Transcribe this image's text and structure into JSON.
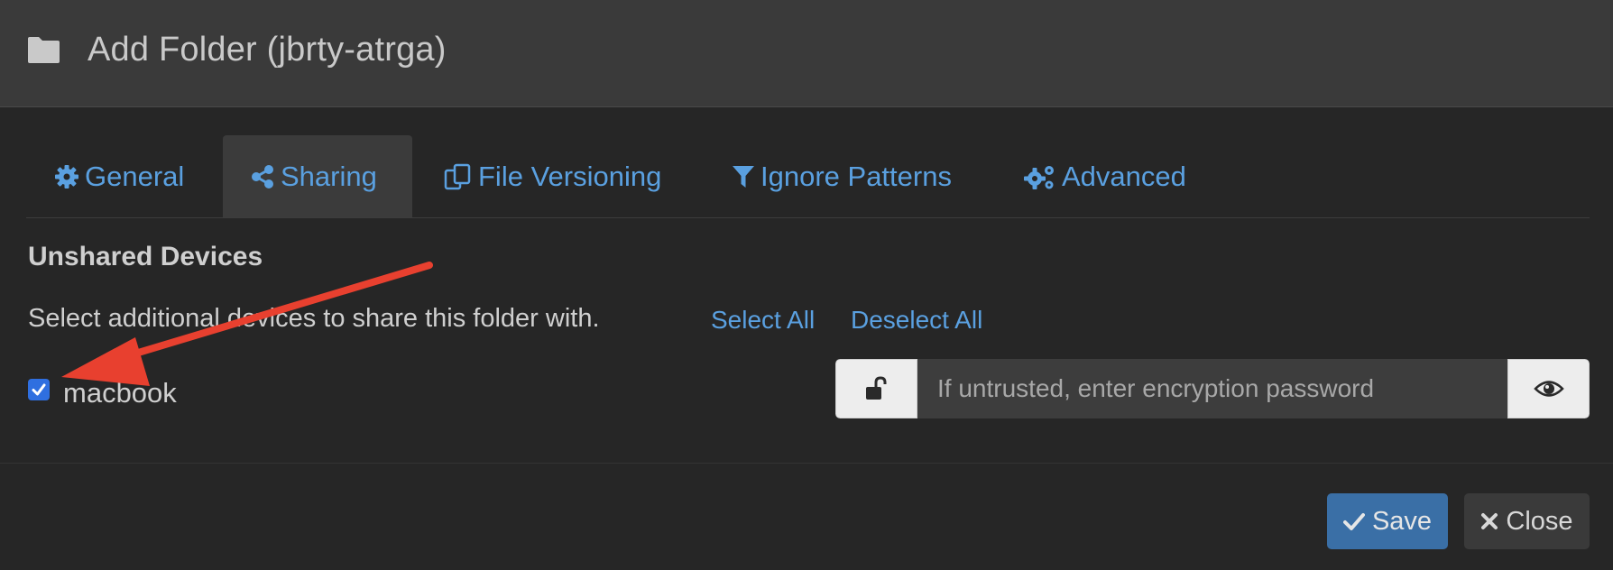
{
  "header": {
    "title": "Add Folder (jbrty-atrga)",
    "icon": "folder-icon"
  },
  "tabs": [
    {
      "label": "General",
      "icon": "gear-icon",
      "active": false
    },
    {
      "label": "Sharing",
      "icon": "share-icon",
      "active": true
    },
    {
      "label": "File Versioning",
      "icon": "copy-icon",
      "active": false
    },
    {
      "label": "Ignore Patterns",
      "icon": "filter-icon",
      "active": false
    },
    {
      "label": "Advanced",
      "icon": "cogs-icon",
      "active": false
    }
  ],
  "sharing": {
    "section_title": "Unshared Devices",
    "help_text": "Select additional devices to share this folder with.",
    "select_all": "Select All",
    "deselect_all": "Deselect All",
    "devices": [
      {
        "name": "macbook",
        "checked": true
      }
    ],
    "password_placeholder": "If untrusted, enter encryption password"
  },
  "footer": {
    "save_label": "Save",
    "close_label": "Close"
  },
  "colors": {
    "link": "#5aa0e0",
    "save_button": "#3a6fa6",
    "annotation_arrow": "#e8402f",
    "checkbox": "#2f6fe0"
  }
}
